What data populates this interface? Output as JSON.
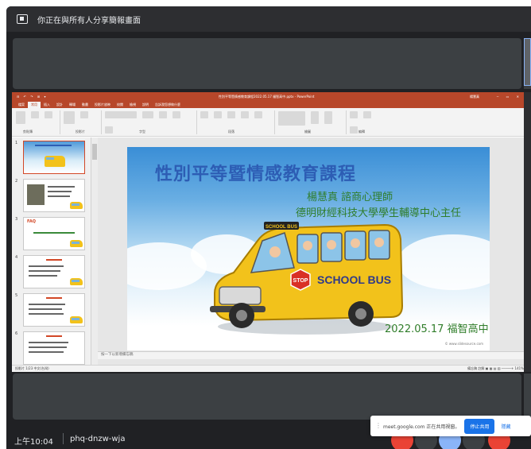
{
  "meet": {
    "banner_text": "你正在與所有人分享簡報畫面",
    "clock": "上午10:04",
    "meeting_code": "phq-dnzw-wja"
  },
  "notification": {
    "text": "meet.google.com 正在共用視窗。",
    "stop_label": "停止共用",
    "hide_label": "隱藏"
  },
  "powerpoint": {
    "quick_access": "⊟ ↶ ↷ ⊞ ▾",
    "doc_title": "性別平等暨情感教育課程2022.05.17 福智高中.pptx - PowerPoint",
    "user": "楊慧真",
    "window_controls": "─ ▭ ✕",
    "tabs": [
      "檔案",
      "常用",
      "插入",
      "設計",
      "轉場",
      "動畫",
      "投影片放映",
      "校閱",
      "檢視",
      "說明",
      "告訴我您想做什麼"
    ],
    "ribbon_groups": [
      "剪貼簿",
      "投影片",
      "字型",
      "段落",
      "繪圖",
      "編輯"
    ],
    "notes_placeholder": "按一下以新增備忘稿",
    "status_left": "投影片 1/23  中文(台灣)",
    "status_right": "備忘稿  註解  ▣ ▦ ▤ ▥  ─────+  141%",
    "thumb_red_label": "FAQ"
  },
  "slide": {
    "title": "性別平等暨情感教育課程",
    "speaker": "楊慧真  諮商心理師",
    "affiliation": "德明財經科技大學學生輔導中心主任",
    "date_location": "2022.05.17  福智高中",
    "bus_sign": "SCHOOL BUS",
    "stop_sign": "STOP",
    "bus_top_sign": "SCHOOL BUS",
    "footer": "© www.slidesource.com"
  },
  "thumbnails": [
    {
      "number": "1"
    },
    {
      "number": "2"
    },
    {
      "number": "3"
    },
    {
      "number": "4"
    },
    {
      "number": "5"
    },
    {
      "number": "6"
    }
  ],
  "colors": {
    "meet_bg": "#202124",
    "ppt_red": "#b7472a",
    "title_blue": "#2d5db4",
    "text_green": "#2f7d2a",
    "bus_yellow": "#f2c21b",
    "stop_red": "#ea4335"
  }
}
